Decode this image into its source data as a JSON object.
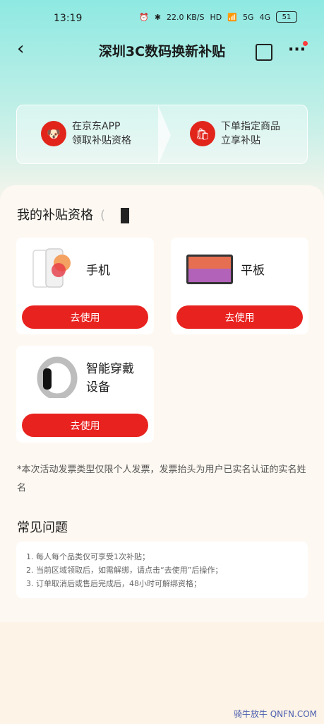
{
  "status_bar": {
    "time": "13:19",
    "net_speed": "22.0 KB/S",
    "badge_hd": "HD",
    "signal_5g": "5G",
    "signal_4g": "4G",
    "battery": "51"
  },
  "header": {
    "title": "深圳3C数码换新补贴",
    "back_icon": "chevron-left-icon",
    "share_icon": "share-icon",
    "more_icon": "more-icon",
    "accent": "#e8221f"
  },
  "steps": [
    {
      "line1": "在京东APP",
      "line2": "领取补贴资格"
    },
    {
      "line1": "下单指定商品",
      "line2": "立享补贴"
    }
  ],
  "qualification": {
    "title": "我的补贴资格",
    "paren": "(",
    "items": [
      {
        "name": "手机",
        "button": "去使用"
      },
      {
        "name": "平板",
        "button": "去使用"
      },
      {
        "name_line1": "智能穿戴",
        "name_line2": "设备",
        "button": "去使用"
      }
    ]
  },
  "note": "*本次活动发票类型仅限个人发票，发票抬头为用户已实名认证的实名姓名",
  "faq": {
    "title": "常见问题",
    "items": [
      "1. 每人每个品类仅可享受1次补贴；",
      "2. 当前区域领取后，如需解绑，请点击“去使用”后操作；",
      "3. 订单取消后或售后完成后，48小时可解绑资格；"
    ]
  },
  "watermark": "骑牛放牛 QNFN.COM"
}
